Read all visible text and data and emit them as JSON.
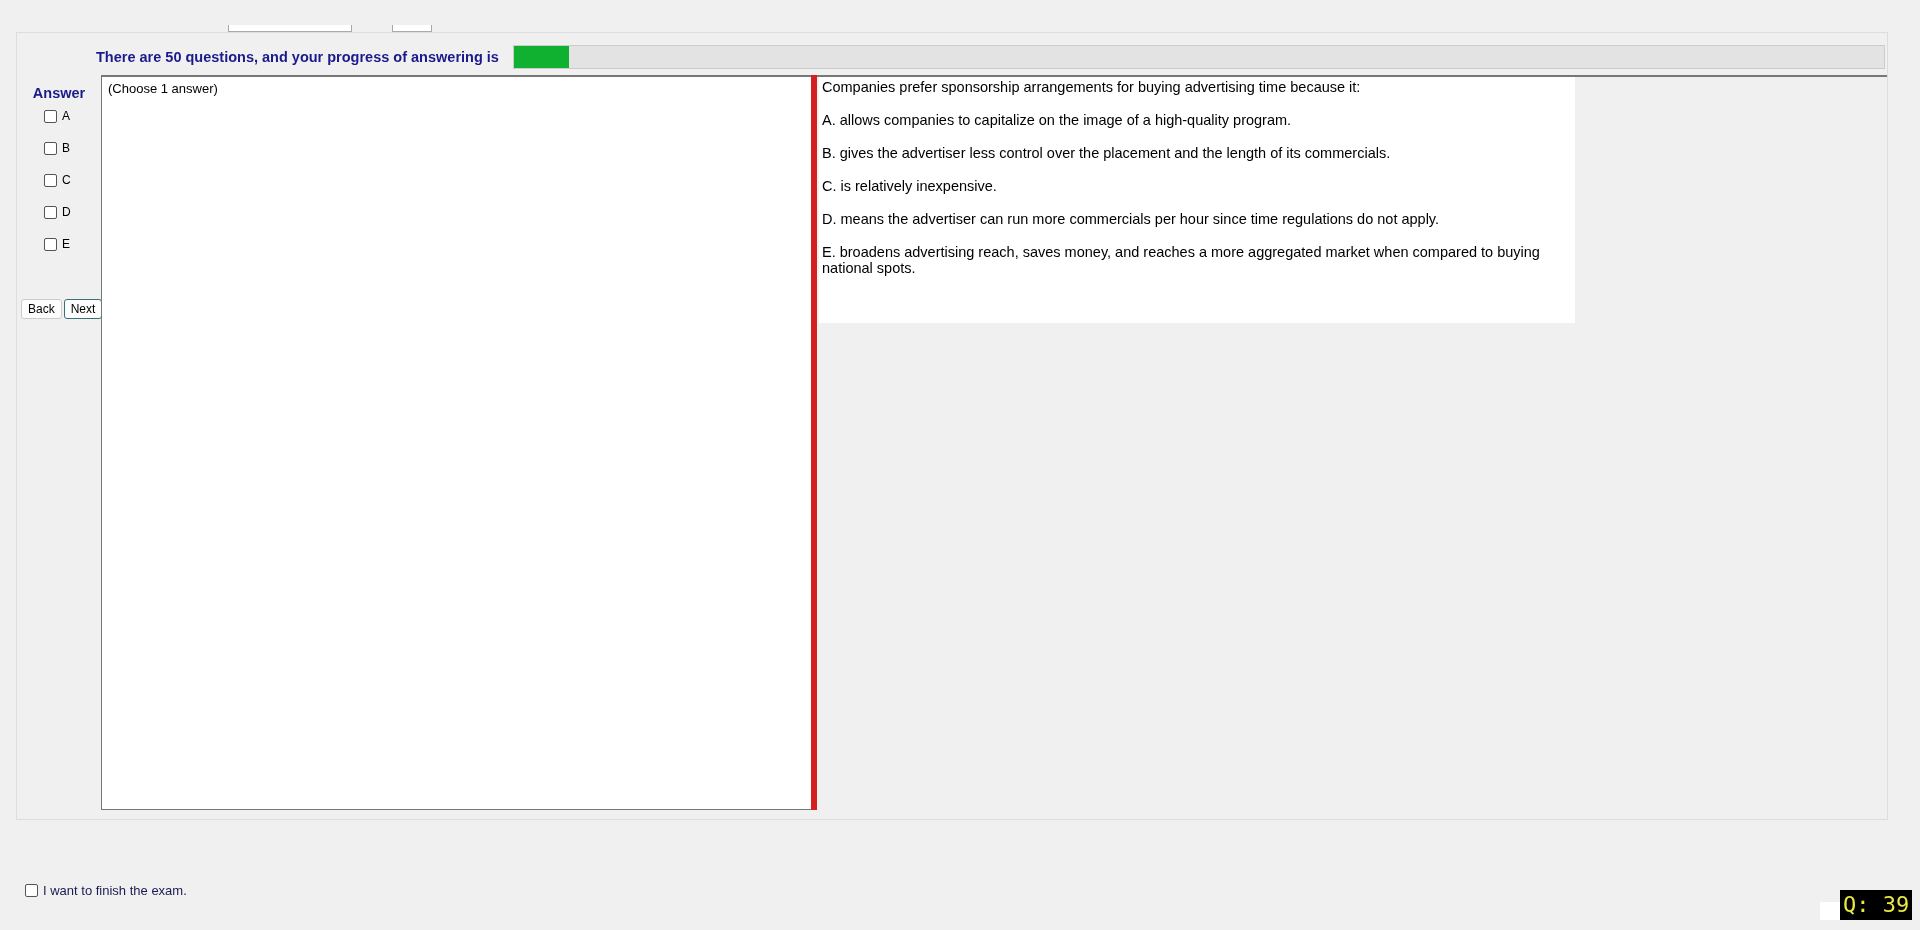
{
  "progress": {
    "label": "There are 50 questions, and your progress of answering is",
    "level": 0.04
  },
  "answer": {
    "heading": "Answer",
    "options": [
      {
        "label": "A",
        "checked": false
      },
      {
        "label": "B",
        "checked": false
      },
      {
        "label": "C",
        "checked": false
      },
      {
        "label": "D",
        "checked": false
      },
      {
        "label": "E",
        "checked": false
      }
    ]
  },
  "buttons": [
    {
      "label": "Back",
      "focused": false
    },
    {
      "label": "Next",
      "focused": true
    }
  ],
  "answer_panel": {
    "hint": "(Choose 1 answer)"
  },
  "question": {
    "stem": "Companies prefer sponsorship arrangements for buying advertising time because it:",
    "choices": [
      "A.  allows companies to capitalize on the image of a high-quality program.",
      "B.  gives the advertiser less control over the placement and the length of its commercials.",
      "C.  is relatively inexpensive.",
      "D.  means the advertiser can run more commercials per hour since time regulations do not apply.",
      "E.  broadens advertising reach, saves money, and reaches a more aggregated market when compared to buying national spots."
    ]
  },
  "finish": {
    "label": "I want to finish the exam.",
    "checked": false
  },
  "question_counter": "Q: 39"
}
